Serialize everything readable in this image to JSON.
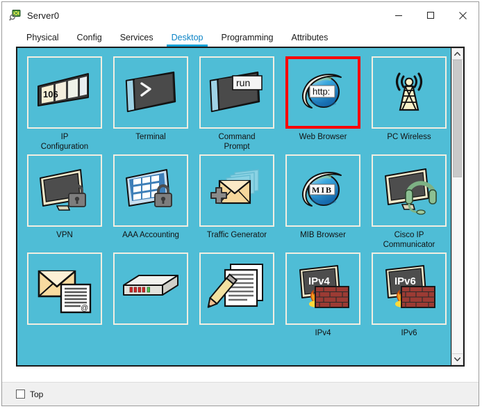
{
  "window": {
    "title": "Server0",
    "app_icon": "packet-tracer-server-icon",
    "controls": {
      "minimize": "minimize-icon",
      "maximize": "maximize-icon",
      "close": "close-icon"
    }
  },
  "tabs": [
    {
      "label": "Physical",
      "active": false
    },
    {
      "label": "Config",
      "active": false
    },
    {
      "label": "Services",
      "active": false
    },
    {
      "label": "Desktop",
      "active": true
    },
    {
      "label": "Programming",
      "active": false
    },
    {
      "label": "Attributes",
      "active": false
    }
  ],
  "desktop": {
    "background_color": "#4fbdd6",
    "tile_border_color": "#f2eee1",
    "selection_color": "#fe0000",
    "rows": [
      [
        {
          "label": "IP\nConfiguration",
          "icon": "ip-configuration-icon",
          "selected": false
        },
        {
          "label": "Terminal",
          "icon": "terminal-icon",
          "selected": false
        },
        {
          "label": "Command\nPrompt",
          "icon": "command-prompt-icon",
          "selected": false
        },
        {
          "label": "Web Browser",
          "icon": "web-browser-icon",
          "selected": true
        },
        {
          "label": "PC Wireless",
          "icon": "pc-wireless-icon",
          "selected": false
        }
      ],
      [
        {
          "label": "VPN",
          "icon": "vpn-icon",
          "selected": false
        },
        {
          "label": "AAA Accounting",
          "icon": "aaa-accounting-icon",
          "selected": false
        },
        {
          "label": "Traffic Generator",
          "icon": "traffic-generator-icon",
          "selected": false
        },
        {
          "label": "MIB Browser",
          "icon": "mib-browser-icon",
          "selected": false
        },
        {
          "label": "Cisco IP Communicator",
          "icon": "cisco-ip-communicator-icon",
          "selected": false
        }
      ],
      [
        {
          "label": "",
          "icon": "email-icon",
          "selected": false
        },
        {
          "label": "",
          "icon": "pppoe-dialer-icon",
          "selected": false
        },
        {
          "label": "",
          "icon": "text-editor-icon",
          "selected": false
        },
        {
          "label": "IPv4",
          "icon": "ipv4-firewall-icon",
          "selected": false
        },
        {
          "label": "IPv6",
          "icon": "ipv6-firewall-icon",
          "selected": false
        }
      ]
    ]
  },
  "scrollbar": {
    "up_arrow": "chevron-up-icon",
    "down_arrow": "chevron-down-icon",
    "thumb_position_percent": 0,
    "thumb_size_percent": 40
  },
  "footer": {
    "top_checkbox_label": "Top",
    "top_checkbox_checked": false
  }
}
